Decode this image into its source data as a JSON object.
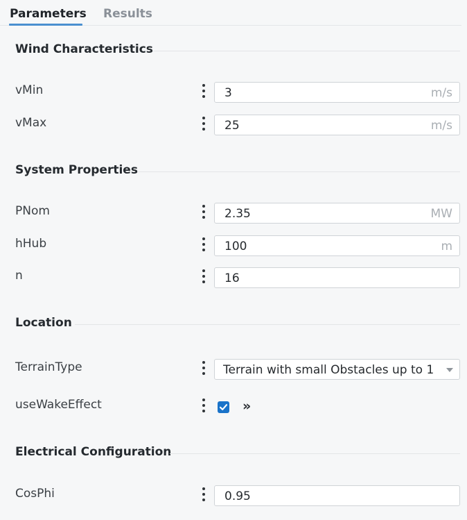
{
  "tabs": [
    {
      "label": "Parameters",
      "active": true
    },
    {
      "label": "Results",
      "active": false
    }
  ],
  "sections": {
    "wind": {
      "title": "Wind Characteristics"
    },
    "system": {
      "title": "System Properties"
    },
    "location": {
      "title": "Location"
    },
    "electrical": {
      "title": "Electrical Configuration"
    }
  },
  "params": {
    "vMin": {
      "label": "vMin",
      "value": "3",
      "unit": "m/s"
    },
    "vMax": {
      "label": "vMax",
      "value": "25",
      "unit": "m/s"
    },
    "PNom": {
      "label": "PNom",
      "value": "2.35",
      "unit": "MW"
    },
    "hHub": {
      "label": "hHub",
      "value": "100",
      "unit": "m"
    },
    "n": {
      "label": "n",
      "value": "16"
    },
    "TerrainType": {
      "label": "TerrainType",
      "value": "Terrain with small Obstacles up to 1"
    },
    "useWakeEffect": {
      "label": "useWakeEffect",
      "checked": true,
      "expand_glyph": "»"
    },
    "CosPhi": {
      "label": "CosPhi",
      "value": "0.95"
    }
  },
  "colors": {
    "accent": "#1a73c9",
    "tab_underline": "#4a8fd0"
  },
  "icons": {
    "menu": "kebab-menu-icon",
    "dropdown": "caret-down-icon",
    "expand": "chevron-double-right-icon",
    "check": "check-icon"
  }
}
